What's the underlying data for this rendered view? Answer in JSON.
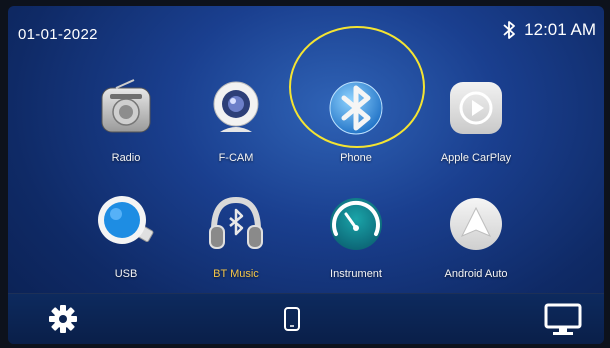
{
  "status": {
    "date": "01-01-2022",
    "time": "12:01 AM",
    "bluetooth_icon": "bluetooth-icon"
  },
  "apps": [
    {
      "id": "radio",
      "label": "Radio",
      "icon": "radio-icon"
    },
    {
      "id": "fcam",
      "label": "F-CAM",
      "icon": "camera-icon"
    },
    {
      "id": "phone",
      "label": "Phone",
      "icon": "bluetooth-phone-icon"
    },
    {
      "id": "carplay",
      "label": "Apple CarPlay",
      "icon": "carplay-play-icon"
    },
    {
      "id": "usb",
      "label": "USB",
      "icon": "usb-icon"
    },
    {
      "id": "btmusic",
      "label": "BT Music",
      "icon": "headphones-bt-icon"
    },
    {
      "id": "instrument",
      "label": "Instrument",
      "icon": "speedometer-icon"
    },
    {
      "id": "androidauto",
      "label": "Android Auto",
      "icon": "android-auto-icon"
    }
  ],
  "dock": {
    "settings_icon": "gear-icon",
    "phone_icon": "phone-outline-icon",
    "display_icon": "monitor-icon"
  },
  "colors": {
    "background": "#1a3f8f",
    "highlight_ring": "#f4e432",
    "bt_music_label": "#f4c64a"
  }
}
